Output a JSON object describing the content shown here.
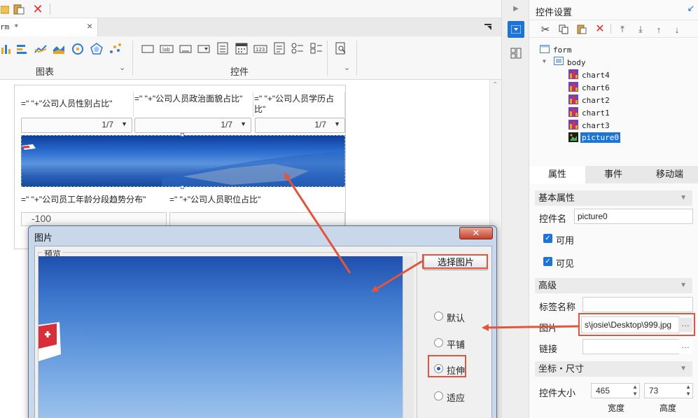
{
  "editor": {
    "tab_label": "rm *",
    "widget_groups": [
      {
        "label": "图表"
      },
      {
        "label": "控件"
      }
    ],
    "form": {
      "chart_titles": [
        "=\"     \"+\"公司人员性别占比\"",
        "=\"     \"+\"公司人员政治面貌占比\"",
        "=\"     \"+\"公司人员学历占比\"",
        "=\"     \"+\"公司员工年龄分段趋势分布\"",
        "=\"     \"+\"公司人员职位占比\""
      ],
      "pager_text": "1/7",
      "axis_value": "-100"
    }
  },
  "dialog": {
    "title": "图片",
    "preview_label": "预览",
    "select_button": "选择图片",
    "fit_options": [
      {
        "label": "默认",
        "selected": false
      },
      {
        "label": "平铺",
        "selected": false
      },
      {
        "label": "拉伸",
        "selected": true
      },
      {
        "label": "适应",
        "selected": false
      }
    ]
  },
  "panel": {
    "title": "控件设置",
    "tree": [
      "form",
      "body",
      "chart4",
      "chart6",
      "chart2",
      "chart1",
      "chart3",
      "picture0"
    ],
    "selected_node": "picture0",
    "tabs": [
      "属性",
      "事件",
      "移动端"
    ],
    "active_tab": "属性",
    "basic_section": "基本属性",
    "name_label": "控件名",
    "name_value": "picture0",
    "enabled_label": "可用",
    "visible_label": "可见",
    "advanced_section": "高级",
    "tag_label": "标签名称",
    "tag_value": "",
    "image_label": "图片",
    "image_value": "s\\josie\\Desktop\\999.jpg",
    "link_label": "链接",
    "link_value": "",
    "geometry_section": "坐标・尺寸",
    "size_label": "控件大小",
    "width_value": "465",
    "height_value": "73",
    "width_label": "宽度",
    "height_label": "高度"
  },
  "colors": {
    "accent": "#1e73d8",
    "highlight": "#e2553d"
  }
}
